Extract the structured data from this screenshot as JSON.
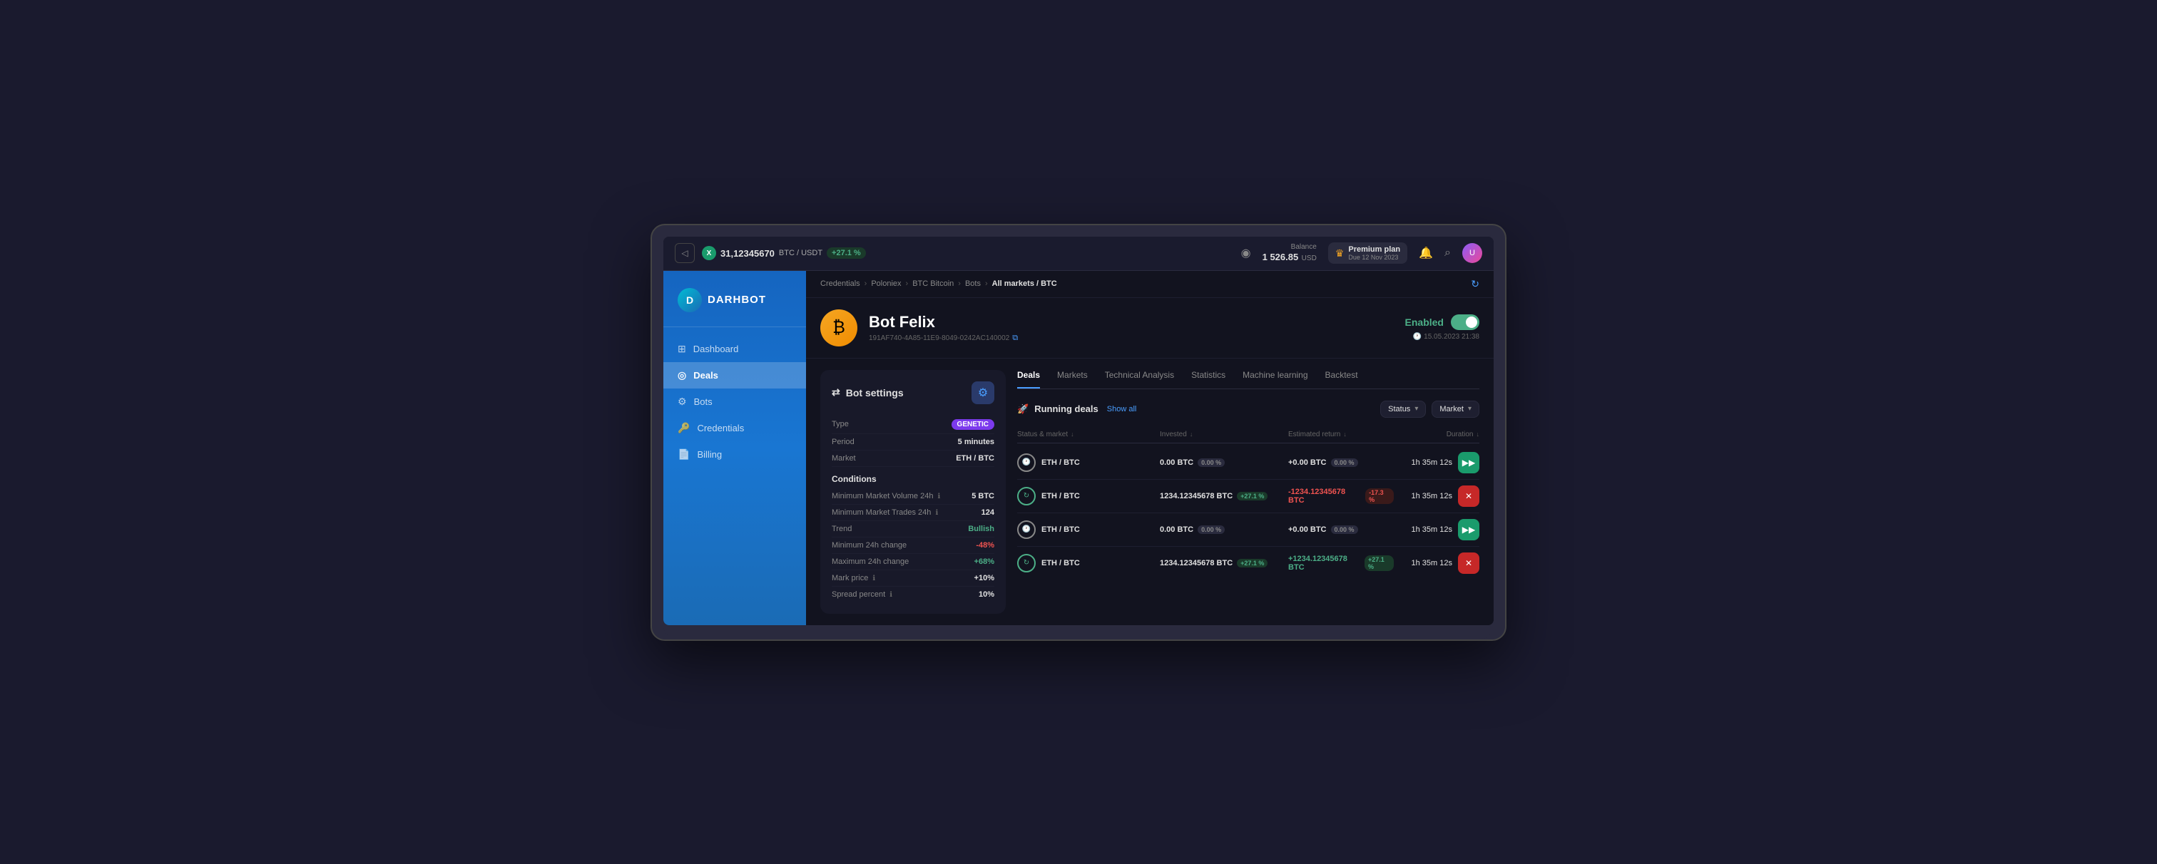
{
  "topbar": {
    "back_icon": "◁",
    "ticker_symbol": "X",
    "ticker_price": "31,12345670",
    "ticker_base": "BTC / USDT",
    "ticker_change": "+27.1 %",
    "eye_icon": "◉",
    "balance_label": "Balance",
    "balance_amount": "1 526.85",
    "balance_currency": "USD",
    "crown_icon": "♛",
    "premium_label": "Premium plan",
    "premium_due": "Due 12 Nov 2023",
    "bell_icon": "🔔",
    "search_icon": "⌕",
    "avatar_initials": "U"
  },
  "sidebar": {
    "logo_text": "DARHBOT",
    "nav_items": [
      {
        "id": "dashboard",
        "label": "Dashboard",
        "icon": "⊞",
        "active": false
      },
      {
        "id": "deals",
        "label": "Deals",
        "icon": "◎",
        "active": true
      },
      {
        "id": "bots",
        "label": "Bots",
        "icon": "⚙",
        "active": false
      },
      {
        "id": "credentials",
        "label": "Credentials",
        "icon": "🔑",
        "active": false
      },
      {
        "id": "billing",
        "label": "Billing",
        "icon": "📄",
        "active": false
      }
    ]
  },
  "breadcrumb": {
    "items": [
      "Credentials",
      "Poloniex",
      "BTC Bitcoin",
      "Bots"
    ],
    "current": "All markets / BTC",
    "separators": [
      "›",
      "›",
      "›",
      "›"
    ]
  },
  "bot_header": {
    "avatar_emoji": "₿",
    "bot_name": "Bot Felix",
    "bot_id": "191AF740-4A85-11E9-8049-0242AC140002",
    "copy_icon": "⧉",
    "status_label": "Enabled",
    "timestamp_icon": "🕐",
    "timestamp": "15.05.2023 21:38",
    "refresh_icon": "↻"
  },
  "bot_settings": {
    "panel_title": "Bot settings",
    "settings_icon": "⚙",
    "rows": [
      {
        "label": "Type",
        "value": "GENETIC",
        "type": "badge"
      },
      {
        "label": "Period",
        "value": "5 minutes",
        "type": "normal"
      },
      {
        "label": "Market",
        "value": "ETH / BTC",
        "type": "normal"
      }
    ],
    "conditions_label": "Conditions",
    "conditions": [
      {
        "label": "Minimum Market Volume 24h",
        "value": "5 BTC",
        "type": "normal",
        "has_info": true
      },
      {
        "label": "Minimum Market Trades 24h",
        "value": "124",
        "type": "normal",
        "has_info": true
      },
      {
        "label": "Trend",
        "value": "Bullish",
        "type": "bullish"
      },
      {
        "label": "Minimum 24h change",
        "value": "-48%",
        "type": "negative"
      },
      {
        "label": "Maximum 24h change",
        "value": "+68%",
        "type": "positive"
      },
      {
        "label": "Mark price",
        "value": "+10%",
        "type": "normal",
        "has_info": true
      },
      {
        "label": "Spread percent",
        "value": "10%",
        "type": "normal",
        "has_info": true
      }
    ]
  },
  "deals_panel": {
    "tabs": [
      "Deals",
      "Markets",
      "Technical Analysis",
      "Statistics",
      "Machine learning",
      "Backtest"
    ],
    "active_tab": "Deals",
    "running_title": "Running deals",
    "show_all_label": "Show all",
    "filter1": "Status",
    "filter2": "Market",
    "table_headers": [
      {
        "label": "Status & market",
        "sortable": true
      },
      {
        "label": "Invested",
        "sortable": true
      },
      {
        "label": "Estimated return",
        "sortable": true
      },
      {
        "label": "Duration",
        "sortable": true
      }
    ],
    "deals": [
      {
        "status_type": "waiting",
        "status_icon": "🕐",
        "market": "ETH",
        "market_sub": "BTC",
        "invested_amount": "0.00",
        "invested_currency": "BTC",
        "invested_pct": "0.00 %",
        "invested_pct_type": "zero",
        "return_amount": "+0.00",
        "return_currency": "BTC",
        "return_pct": "0.00 %",
        "return_pct_type": "zero",
        "return_type": "zero",
        "duration": "1h 35m 12s",
        "action_type": "green",
        "action_icon": "▶▶"
      },
      {
        "status_type": "running",
        "status_icon": "↻",
        "market": "ETH",
        "market_sub": "BTC",
        "invested_amount": "1234.12345678",
        "invested_currency": "BTC",
        "invested_pct": "+27.1 %",
        "invested_pct_type": "positive",
        "return_amount": "-1234.12345678",
        "return_currency": "BTC",
        "return_pct": "-17.3 %",
        "return_pct_type": "negative",
        "return_type": "negative",
        "duration": "1h 35m 12s",
        "action_type": "red",
        "action_icon": "✕"
      },
      {
        "status_type": "waiting",
        "status_icon": "🕐",
        "market": "ETH",
        "market_sub": "BTC",
        "invested_amount": "0.00",
        "invested_currency": "BTC",
        "invested_pct": "0.00 %",
        "invested_pct_type": "zero",
        "return_amount": "+0.00",
        "return_currency": "BTC",
        "return_pct": "0.00 %",
        "return_pct_type": "zero",
        "return_type": "zero",
        "duration": "1h 35m 12s",
        "action_type": "green",
        "action_icon": "▶▶"
      },
      {
        "status_type": "running",
        "status_icon": "↻",
        "market": "ETH",
        "market_sub": "BTC",
        "invested_amount": "1234.12345678",
        "invested_currency": "BTC",
        "invested_pct": "+27.1 %",
        "invested_pct_type": "positive",
        "return_amount": "+1234.12345678",
        "return_currency": "BTC",
        "return_pct": "+27.1 %",
        "return_pct_type": "positive",
        "return_type": "positive",
        "duration": "1h 35m 12s",
        "action_type": "red",
        "action_icon": "✕"
      }
    ]
  }
}
